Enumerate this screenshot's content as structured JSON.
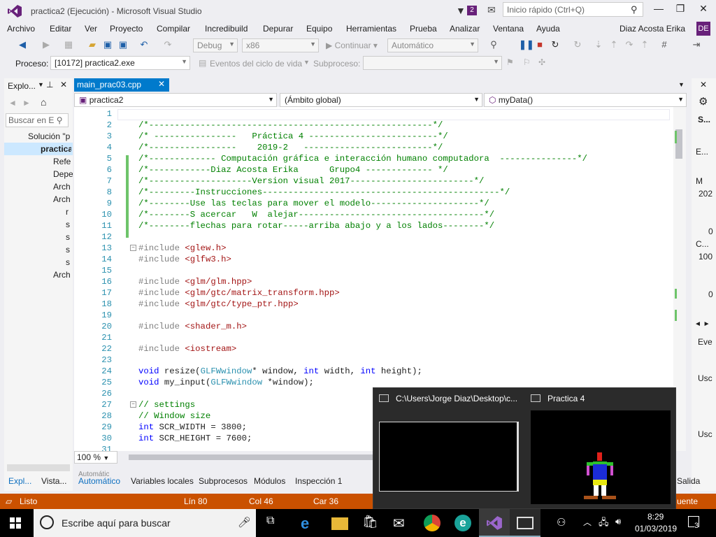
{
  "window": {
    "title": "practica2 (Ejecución) - Microsoft Visual Studio",
    "notification_count": "2",
    "quick_launch_placeholder": "Inicio rápido (Ctrl+Q)"
  },
  "menu": {
    "items": [
      "Archivo",
      "Editar",
      "Ver",
      "Proyecto",
      "Compilar",
      "Incredibuild",
      "Depurar",
      "Equipo",
      "Herramientas",
      "Prueba",
      "Analizar",
      "Ventana",
      "Ayuda"
    ],
    "user": "Diaz Acosta Erika",
    "user_initials": "DE"
  },
  "toolbar": {
    "config": "Debug",
    "platform": "x86",
    "continue_label": "Continuar",
    "mode": "Automático"
  },
  "procbar": {
    "process_label": "Proceso:",
    "process_value": "[10172] practica2.exe",
    "lifecycle_label": "Eventos del ciclo de vida",
    "subprocess_label": "Subproceso:"
  },
  "solution_explorer": {
    "title": "Explo...",
    "search_placeholder": "Buscar en E",
    "items": [
      {
        "label": "Solución \"p"
      },
      {
        "label": "practica"
      },
      {
        "label": "Refe"
      },
      {
        "label": "Depe"
      },
      {
        "label": "Arch"
      },
      {
        "label": "Arch"
      },
      {
        "label": "r"
      },
      {
        "label": "s"
      },
      {
        "label": "s"
      },
      {
        "label": "s"
      },
      {
        "label": "s"
      },
      {
        "label": "Arch"
      }
    ]
  },
  "editor": {
    "tab": "main_prac03.cpp",
    "nav_project": "practica2",
    "nav_scope": "(Ámbito global)",
    "nav_member": "myData()",
    "zoom": "100 %"
  },
  "code": {
    "line_numbers": [
      "1",
      "2",
      "3",
      "4",
      "5",
      "6",
      "7",
      "8",
      "9",
      "10",
      "11",
      "12",
      "13",
      "14",
      "15",
      "16",
      "17",
      "18",
      "19",
      "20",
      "21",
      "22",
      "23",
      "24",
      "25",
      "26",
      "27",
      "28",
      "29",
      "30",
      "31"
    ],
    "lines": [
      "",
      "/*-------------------------------------------------------*/",
      "/* ----------------   Práctica 4 -------------------------*/",
      "/*-----------------    2019-2   -------------------------*/",
      "/*------------- Computación gráfica e interacción humano computadora  ---------------*/",
      "/*------------Diaz Acosta Erika      Grupo4 ------------- */",
      "/*--------------------Version visual 2017------------------------*/",
      "/*---------Instrucciones----------------------------------------------*/",
      "/*--------Use las teclas para mover el modelo---------------------*/",
      "/*--------S acercar   W  alejar------------------------------------*/",
      "/*--------flechas para rotar-----arriba abajo y a los lados--------*/",
      "",
      "#include <glew.h>",
      "#include <glfw3.h>",
      "",
      "#include <glm/glm.hpp>",
      "#include <glm/gtc/matrix_transform.hpp>",
      "#include <glm/gtc/type_ptr.hpp>",
      "",
      "#include <shader_m.h>",
      "",
      "#include <iostream>",
      "",
      "void resize(GLFWwindow* window, int width, int height);",
      "void my_input(GLFWwindow *window);",
      "",
      "// settings",
      "// Window size",
      "int SCR_WIDTH = 3800;",
      "int SCR_HEIGHT = 7600;",
      ""
    ]
  },
  "bottom_tabs": {
    "left": [
      "Expl...",
      "Vista..."
    ],
    "center": [
      "Automático",
      "Variables locales",
      "Subprocesos",
      "Módulos",
      "Inspección 1"
    ],
    "right": "Salida",
    "partial": "Automátic"
  },
  "status": {
    "state": "Listo",
    "line": "Lín 80",
    "col": "Col 46",
    "char": "Car 36",
    "right": "uente"
  },
  "right_panel": {
    "labels": [
      "S...",
      "E...",
      "M",
      "202",
      "0",
      "C...",
      "100",
      "0",
      "Eve",
      "Usc",
      "Usc"
    ]
  },
  "popup": {
    "console_title": "C:\\Users\\Jorge Diaz\\Desktop\\c...",
    "app_title": "Practica 4"
  },
  "taskbar": {
    "search_placeholder": "Escribe aquí para buscar",
    "time": "8:29",
    "date": "01/03/2019",
    "notification_count": "3"
  }
}
